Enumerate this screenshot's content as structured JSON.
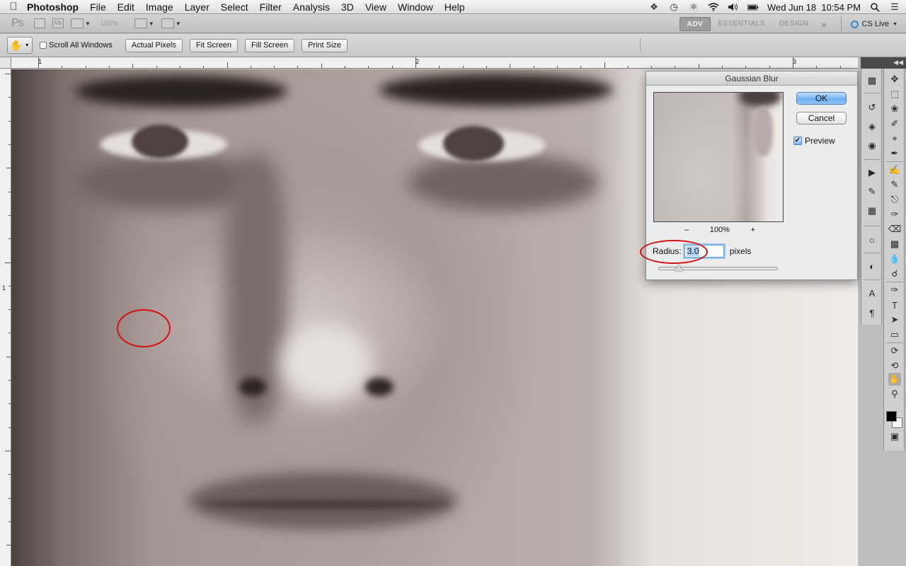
{
  "menubar": {
    "apple": "",
    "app_name": "Photoshop",
    "items": [
      "File",
      "Edit",
      "Image",
      "Layer",
      "Select",
      "Filter",
      "Analysis",
      "3D",
      "View",
      "Window",
      "Help"
    ],
    "clock": "Wed Jun 18  10:54 PM"
  },
  "appbar": {
    "logo": "Ps",
    "mb_label": "Mb",
    "zoom": "100%",
    "workspaces": [
      "ADV",
      "ESSENTIALS",
      "DESIGN"
    ],
    "active_workspace": "ADV",
    "more": "»",
    "cs_live": "CS Live"
  },
  "options": {
    "scroll_all": "Scroll All Windows",
    "buttons": [
      "Actual Pixels",
      "Fit Screen",
      "Fill Screen",
      "Print Size"
    ]
  },
  "rulers": {
    "top": [
      "1",
      "2",
      "3"
    ],
    "left": [
      "1"
    ]
  },
  "dialog": {
    "title": "Gaussian Blur",
    "ok": "OK",
    "cancel": "Cancel",
    "preview_label": "Preview",
    "preview_checked": true,
    "check_glyph": "✔",
    "zoom_minus": "–",
    "zoom_value": "100%",
    "zoom_plus": "+",
    "radius_label": "Radius:",
    "radius_value": "3.0",
    "radius_unit": "pixels",
    "slider_fraction": 0.17
  },
  "colors": {
    "annotation": "#d80f12",
    "ok_button": "#6fb0f1",
    "foreground": "#000000",
    "background": "#ffffff"
  },
  "icons": {
    "tray": [
      "dropbox-icon",
      "time-machine-icon",
      "bluetooth-icon",
      "wifi-icon",
      "volume-icon",
      "battery-icon",
      "search-icon",
      "list-icon"
    ],
    "panels_left": [
      "mini-bridge-icon",
      "history-icon",
      "layers-icon",
      "channels-icon",
      "actions-icon",
      "brush-presets-icon",
      "swatches-icon",
      "adjustments-icon",
      "masks-icon",
      "character-icon",
      "paragraph-icon"
    ],
    "tools": [
      "move-tool-icon",
      "marquee-tool-icon",
      "lasso-tool-icon",
      "quick-select-tool-icon",
      "crop-tool-icon",
      "eyedropper-tool-icon",
      "healing-brush-icon",
      "brush-tool-icon",
      "clone-stamp-icon",
      "history-brush-icon",
      "eraser-tool-icon",
      "gradient-tool-icon",
      "blur-tool-icon",
      "dodge-tool-icon",
      "pen-tool-icon",
      "type-tool-icon",
      "path-select-icon",
      "shape-tool-icon",
      "3d-rotate-icon",
      "3d-orbit-icon",
      "hand-tool-icon",
      "zoom-tool-icon",
      "quick-mask-icon"
    ]
  }
}
